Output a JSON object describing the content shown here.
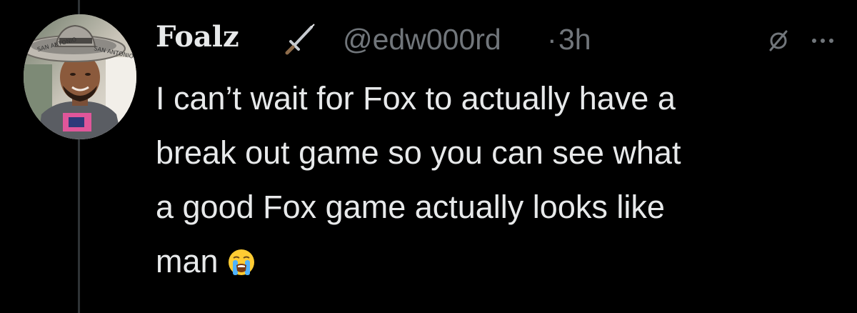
{
  "tweet": {
    "display_name": "Foalz",
    "display_name_icon": "dagger-icon",
    "handle": "@edw000rd",
    "separator": "·",
    "timestamp": "3h",
    "actions": [
      "null-icon",
      "more-icon"
    ],
    "text_lines": [
      "I can’t wait for Fox to actually have a",
      "break out game so you can see what",
      "a good Fox game actually looks like",
      "man"
    ],
    "emoji": "loudly-crying-face",
    "avatar": {
      "hat_text_left": "SAN ANTONIO",
      "hat_text_right": "SAN ANTONIO"
    }
  },
  "colors": {
    "background": "#000000",
    "text": "#e7e9ea",
    "secondary": "#71767b",
    "thread_line": "#2f3336"
  }
}
